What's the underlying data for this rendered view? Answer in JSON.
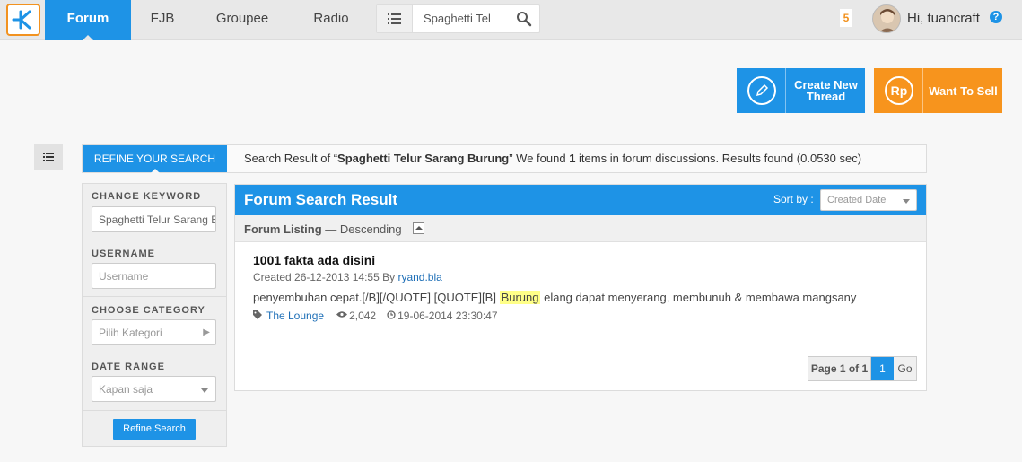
{
  "nav": {
    "items": [
      "Forum",
      "FJB",
      "Groupee",
      "Radio"
    ],
    "search_value": "Spaghetti Tel",
    "notification_count": "5",
    "greeting": "Hi, tuancraft",
    "help": "?"
  },
  "actions": {
    "create_thread": "Create New Thread",
    "want_to_sell": "Want To Sell",
    "sell_icon_text": "Rp"
  },
  "refine": {
    "tab_label": "REFINE YOUR SEARCH",
    "summary_prefix": "Search Result of “",
    "query": "Spaghetti Telur Sarang Burung",
    "summary_mid": "” We found ",
    "count": "1",
    "summary_suffix": " items in forum discussions. Results found (0.0530 sec)"
  },
  "filters": {
    "keyword_label": "CHANGE KEYWORD",
    "keyword_value": "Spaghetti Telur Sarang Burung",
    "username_label": "USERNAME",
    "username_placeholder": "Username",
    "category_label": "CHOOSE CATEGORY",
    "category_value": "Pilih Kategori",
    "date_label": "DATE RANGE",
    "date_value": "Kapan saja",
    "refine_button": "Refine Search"
  },
  "results": {
    "title": "Forum Search Result",
    "sort_label": "Sort by :",
    "sort_value": "Created Date",
    "listing_label": "Forum Listing",
    "listing_order": " — Descending",
    "threads": [
      {
        "title": "1001 fakta ada disini",
        "created": "Created 26-12-2013 14:55 By ",
        "author": "ryand.bla",
        "excerpt_before": "penyembuhan cepat.[/B][/QUOTE] [QUOTE][B] ",
        "excerpt_highlight": "Burung",
        "excerpt_after": " elang dapat menyerang, membunuh & membawa mangsany",
        "category": "The Lounge",
        "views": "2,042",
        "last_post": "19-06-2014 23:30:47"
      }
    ],
    "pager": {
      "label": "Page 1 of 1",
      "current": "1",
      "go": "Go"
    }
  }
}
